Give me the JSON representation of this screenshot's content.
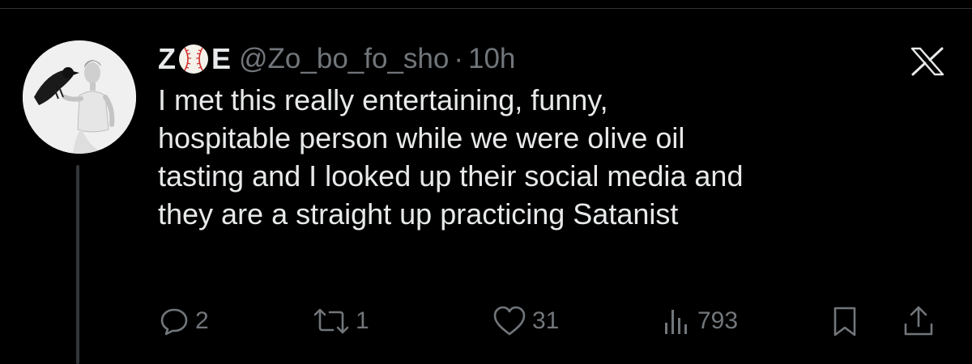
{
  "tweet": {
    "author": {
      "name_start": "Z",
      "name_emoji": "baseball-emoji",
      "name_end": "E",
      "handle": "@Zo_bo_fo_sho",
      "separator": "·",
      "time": "10h"
    },
    "text_lines": [
      "I met this really entertaining, funny,",
      "hospitable person while we were olive oil",
      "tasting and I looked up their social media and",
      "they are a straight up practicing Satanist"
    ]
  },
  "actions": {
    "replies": "2",
    "reposts": "1",
    "likes": "31",
    "views": "793"
  },
  "icons": {
    "reply": "reply-icon",
    "repost": "repost-icon",
    "like": "heart-icon",
    "views": "views-icon",
    "bookmark": "bookmark-icon",
    "share": "share-icon",
    "brand": "x-logo-icon"
  },
  "colors": {
    "background": "#000000",
    "text": "#e7e9ea",
    "muted": "#71767b",
    "baseball_stitch": "#d0312d"
  }
}
